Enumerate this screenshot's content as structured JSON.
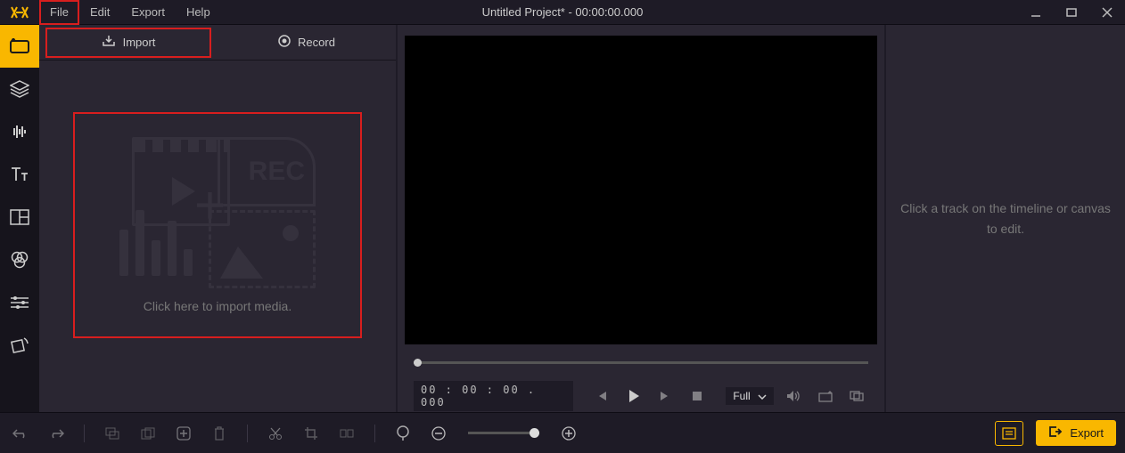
{
  "menu": {
    "file": "File",
    "edit": "Edit",
    "export": "Export",
    "help": "Help"
  },
  "title": "Untitled Project* - 00:00:00.000",
  "tabs": {
    "import": "Import",
    "record": "Record"
  },
  "import_placeholder": "Click here to import media.",
  "import_art_rec": "REC",
  "preview": {
    "timecode": "00 : 00 : 00 . 000",
    "zoom": "Full"
  },
  "rightpanel": {
    "hint": "Click a track on the timeline or canvas to edit."
  },
  "bottombar": {
    "export": "Export"
  }
}
